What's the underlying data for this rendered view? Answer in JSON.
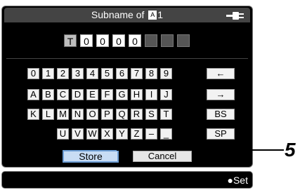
{
  "dialog": {
    "title_prefix": "Subname of",
    "title_badge": "A",
    "title_suffix": "1",
    "power_icon": "plug-icon"
  },
  "name_field": {
    "chars": [
      "T",
      "0",
      "0",
      "0",
      "0",
      "",
      "",
      ""
    ]
  },
  "keyboard": {
    "row1": [
      "0",
      "1",
      "2",
      "3",
      "4",
      "5",
      "6",
      "7",
      "8",
      "9"
    ],
    "row1_special": "←",
    "row2": [
      "A",
      "B",
      "C",
      "D",
      "E",
      "F",
      "G",
      "H",
      "I",
      "J"
    ],
    "row2_special": "→",
    "row3": [
      "K",
      "L",
      "M",
      "N",
      "O",
      "P",
      "Q",
      "R",
      "S",
      "T"
    ],
    "row3_special": "BS",
    "row4": [
      "U",
      "V",
      "W",
      "X",
      "Y",
      "Z",
      "–",
      "_"
    ],
    "row4_special": "SP"
  },
  "buttons": {
    "store": "Store",
    "cancel": "Cancel"
  },
  "footer": {
    "set": "●Set"
  },
  "callout": {
    "number": "5"
  },
  "colors": {
    "screen_bg": "#000000",
    "title_bar": "#444444",
    "key_bg": "#f2f2f2",
    "selected_button": "#c8dcf4"
  }
}
